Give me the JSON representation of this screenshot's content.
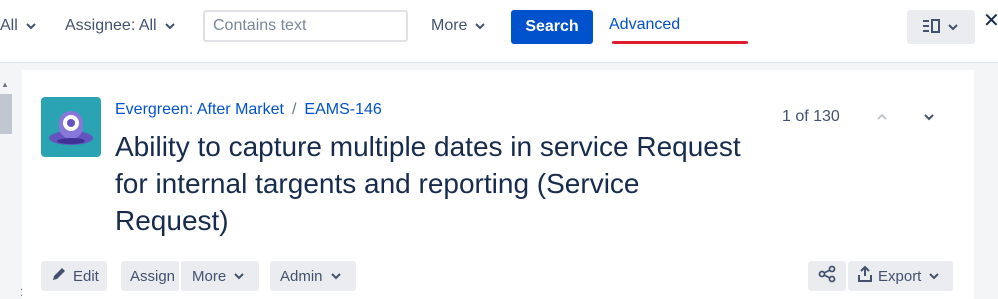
{
  "filters": {
    "prev_fragment": "All",
    "assignee": "Assignee: All",
    "search_placeholder": "Contains text",
    "more": "More",
    "search_button": "Search",
    "advanced_link": "Advanced"
  },
  "issue": {
    "project": "Evergreen: After Market",
    "separator": "/",
    "key": "EAMS-146",
    "title": "Ability to capture multiple dates in service Request for internal targents and reporting (Service Request)",
    "pager": "1 of 130"
  },
  "toolbar": {
    "edit": "Edit",
    "assign": "Assign",
    "more": "More",
    "admin": "Admin",
    "export": "Export"
  },
  "colors": {
    "primary": "#0052cc",
    "annotation_underline": "#de1e2e",
    "avatar_bg": "#2aa3b3"
  },
  "icons": [
    "chevron-down-icon",
    "view-layout-icon",
    "close-icon",
    "pencil-icon",
    "share-icon",
    "export-icon",
    "chevron-up-icon"
  ]
}
